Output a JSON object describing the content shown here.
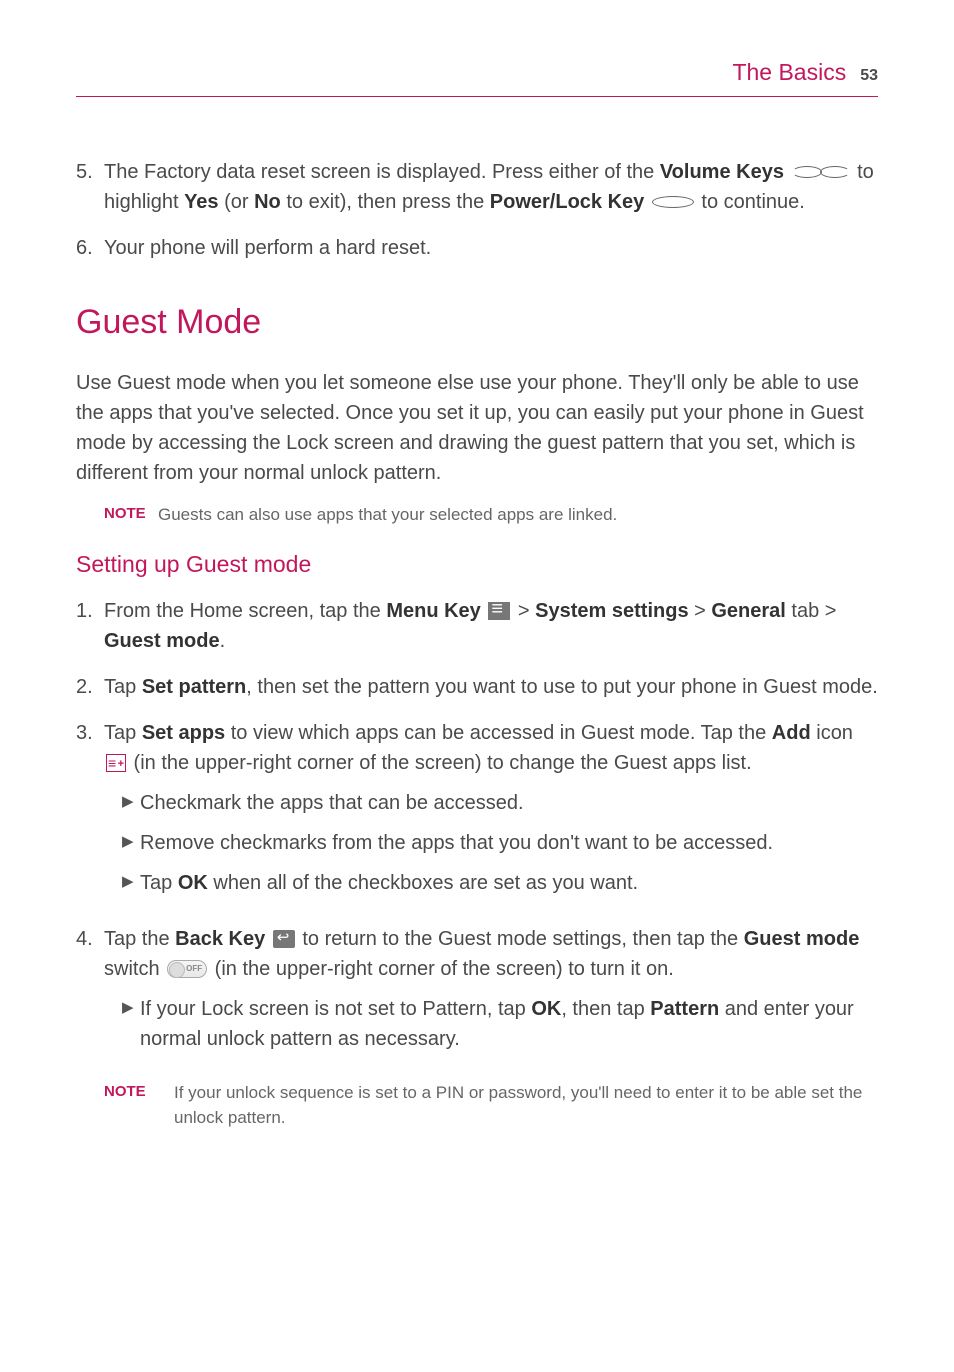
{
  "header": {
    "title": "The Basics",
    "page": "53"
  },
  "top_list": {
    "item5_num": "5.",
    "item5_a": "The Factory data reset screen is displayed. Press either of the ",
    "item5_b": "Volume Keys",
    "item5_c": " to highlight ",
    "item5_d": "Yes",
    "item5_e": " (or ",
    "item5_f": "No",
    "item5_g": " to exit), then press the ",
    "item5_h": "Power/Lock Key",
    "item5_i": " to continue.",
    "item6_num": "6.",
    "item6": "Your phone will perform a hard reset."
  },
  "h1": "Guest Mode",
  "intro": "Use Guest mode when you let someone else use your phone. They'll only be able to use the apps that you've selected. Once you set it up, you can easily put your phone in Guest mode by accessing the Lock screen and drawing the guest pattern that you set, which is different from your normal unlock pattern.",
  "note1_label": "NOTE",
  "note1": "Guests can also use apps that your selected apps are linked.",
  "h2": "Setting up Guest mode",
  "steps": {
    "s1_num": "1.",
    "s1_a": "From the Home screen, tap the ",
    "s1_b": "Menu Key",
    "s1_c": " > ",
    "s1_d": "System settings",
    "s1_e": " > ",
    "s1_f": "General",
    "s1_g": " tab > ",
    "s1_h": "Guest mode",
    "s1_i": ".",
    "s2_num": "2.",
    "s2_a": "Tap ",
    "s2_b": "Set pattern",
    "s2_c": ", then set the pattern you want to use to put your phone in Guest mode.",
    "s3_num": "3.",
    "s3_a": "Tap ",
    "s3_b": "Set apps",
    "s3_c": " to view which apps can be accessed in Guest mode. Tap the ",
    "s3_d": "Add",
    "s3_e": " icon ",
    "s3_f": " (in the upper-right corner of the screen) to change the Guest apps list.",
    "s3_sub1": "Checkmark the apps that can be accessed.",
    "s3_sub2": "Remove checkmarks from the apps that you don't want to be accessed.",
    "s3_sub3_a": "Tap ",
    "s3_sub3_b": "OK",
    "s3_sub3_c": " when all of the checkboxes are set as you want.",
    "s4_num": "4.",
    "s4_a": "Tap the ",
    "s4_b": "Back Key",
    "s4_c": " to return to the Guest mode settings, then tap the ",
    "s4_d": "Guest mode",
    "s4_e": " switch ",
    "s4_f": " (in the upper-right corner of the screen) to turn it on.",
    "s4_sub1_a": "If your Lock screen is not set to Pattern, tap ",
    "s4_sub1_b": "OK",
    "s4_sub1_c": ", then tap ",
    "s4_sub1_d": "Pattern",
    "s4_sub1_e": " and enter your normal unlock pattern as necessary."
  },
  "note2_label": "NOTE",
  "note2": "If your unlock sequence is set to a PIN or password, you'll need to enter it to be able set the unlock pattern."
}
